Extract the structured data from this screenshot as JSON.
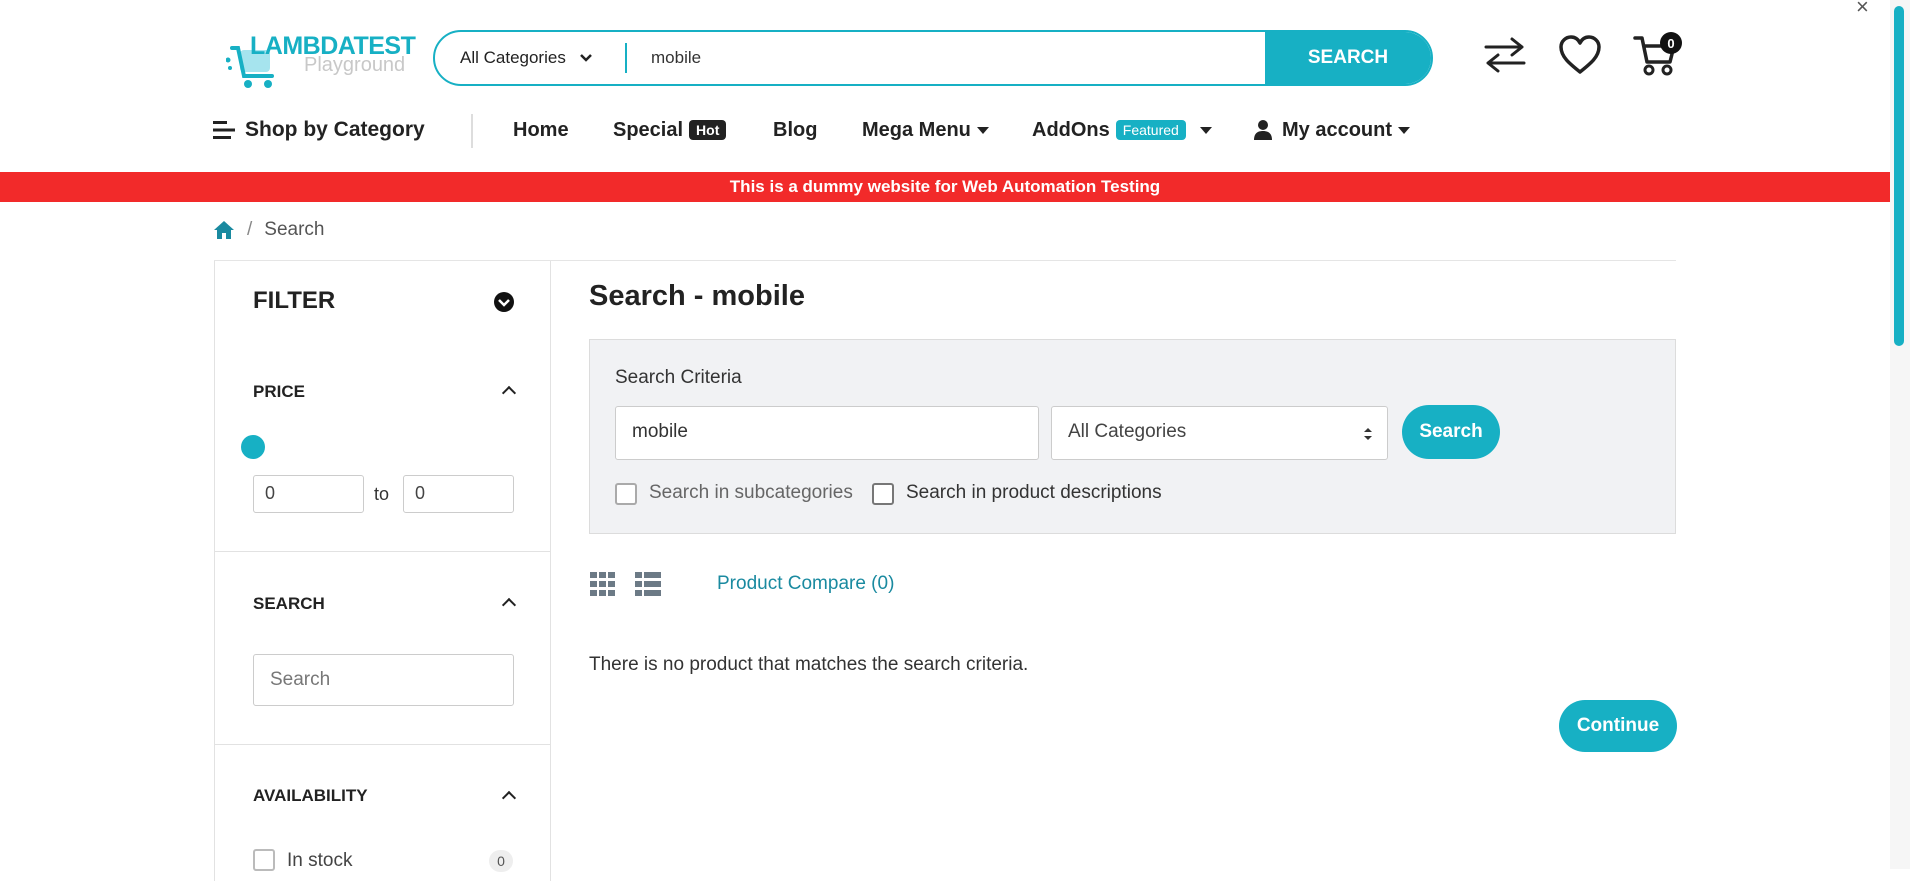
{
  "header": {
    "logo_main": "LAMBDATEST",
    "logo_sub": "Playground",
    "search_category": "All Categories",
    "search_value": "mobile",
    "search_button": "SEARCH",
    "cart_count": "0"
  },
  "nav": {
    "shop_by_category": "Shop by Category",
    "home": "Home",
    "special": "Special",
    "special_tag": "Hot",
    "blog": "Blog",
    "mega_menu": "Mega Menu",
    "addons": "AddOns",
    "addons_tag": "Featured",
    "my_account": "My account"
  },
  "banner": "This is a dummy website for Web Automation Testing",
  "breadcrumb": {
    "separator": "/",
    "current": "Search"
  },
  "sidebar": {
    "title": "FILTER",
    "price_title": "PRICE",
    "price_min": "0",
    "price_to": "to",
    "price_max": "0",
    "search_title": "SEARCH",
    "search_placeholder": "Search",
    "availability_title": "AVAILABILITY",
    "in_stock_label": "In stock",
    "in_stock_count": "0"
  },
  "main": {
    "title": "Search - mobile",
    "criteria_label": "Search Criteria",
    "criteria_input": "mobile",
    "criteria_category": "All Categories",
    "criteria_button": "Search",
    "subcategories_label": "Search in subcategories",
    "descriptions_label": "Search in product descriptions",
    "product_compare": "Product Compare (0)",
    "no_product": "There is no product that matches the search criteria.",
    "continue_button": "Continue"
  },
  "colors": {
    "accent": "#17b0c4",
    "banner": "#f22a2a",
    "dark_tag": "#222222"
  },
  "icons": [
    "cart-logo-icon",
    "chevron-down-icon",
    "compare-icon",
    "heart-icon",
    "cart-icon",
    "menu-icon",
    "user-icon",
    "home-icon",
    "grid-view-icon",
    "list-view-icon",
    "close-icon"
  ]
}
